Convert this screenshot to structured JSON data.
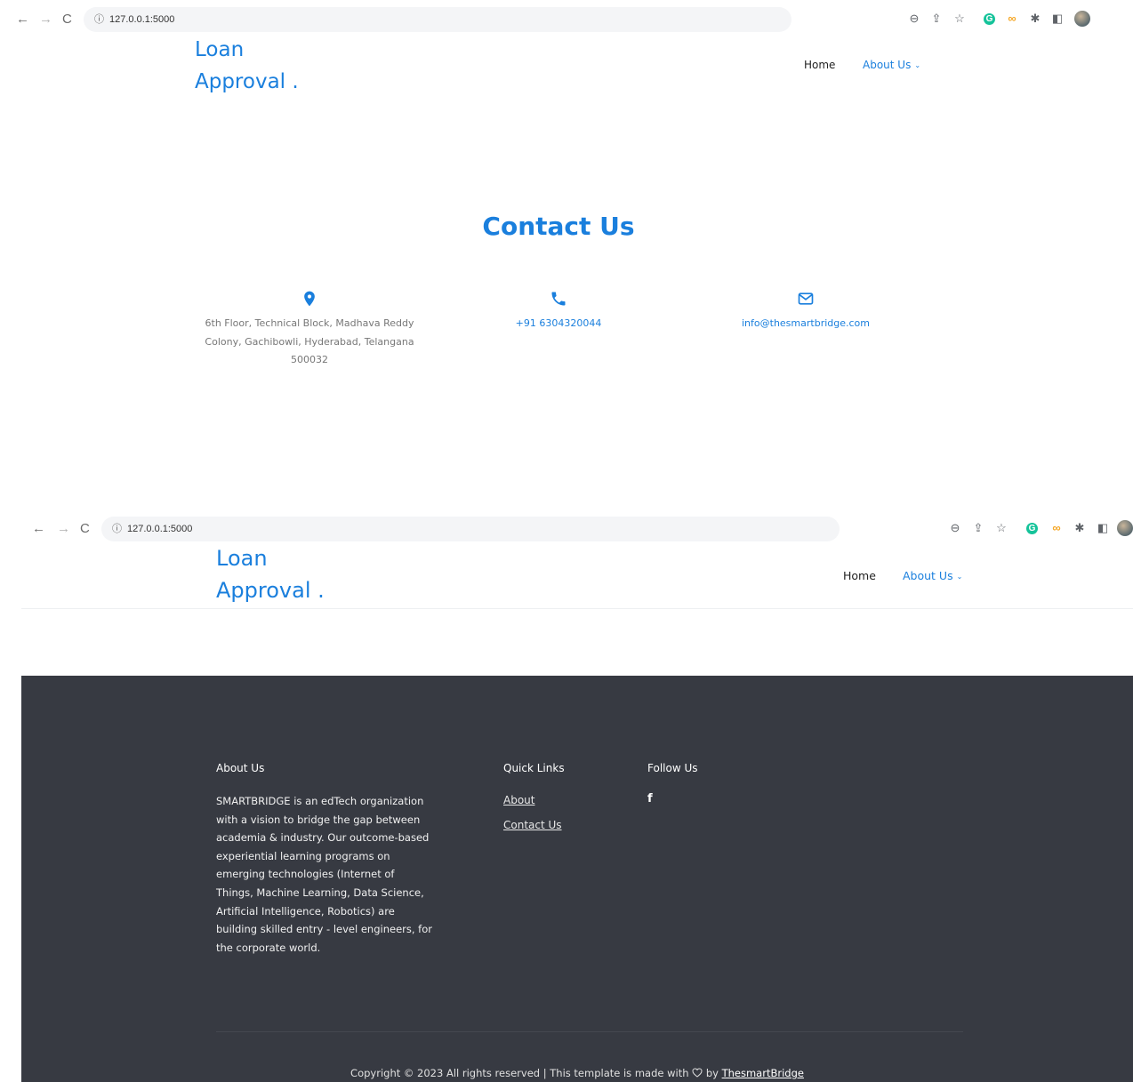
{
  "browser": {
    "url": "127.0.0.1:5000"
  },
  "site": {
    "brand_line1": "Loan",
    "brand_line2": "Approval .",
    "nav": {
      "home": "Home",
      "about": "About Us",
      "about_chevron": "⌄"
    }
  },
  "contact": {
    "title": "Contact Us",
    "address": "6th Floor, Technical Block, Madhava Reddy Colony, Gachibowli, Hyderabad, Telangana 500032",
    "phone": "+91 6304320044",
    "email": "info@thesmartbridge.com",
    "icons": {
      "address": "map-marker-icon",
      "phone": "phone-icon",
      "email": "envelope-icon"
    }
  },
  "footer": {
    "about_heading": "About Us",
    "about_text": "SMARTBRIDGE is an edTech organization with a vision to bridge the gap between academia & industry. Our outcome-based experiential learning programs on emerging technologies (Internet of Things, Machine Learning, Data Science, Artificial Intelligence, Robotics) are building skilled entry - level engineers, for the corporate world.",
    "quick_links_heading": "Quick Links",
    "quick_links": [
      "About",
      "Contact Us"
    ],
    "follow_heading": "Follow Us",
    "follow_icon": "facebook-icon",
    "copyright_prefix": "Copyright © 2023 All rights reserved | This template is made with",
    "copyright_by": "by",
    "copyright_brand": "ThesmartBridge"
  },
  "colors": {
    "accent": "#1a7fdd",
    "footer_bg": "#373a42"
  }
}
